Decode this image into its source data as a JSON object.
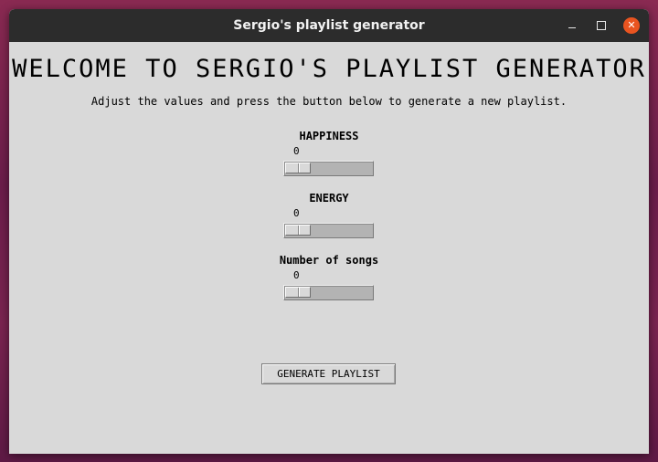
{
  "window": {
    "title": "Sergio's playlist generator",
    "close_glyph": "✕",
    "controls": [
      "minimize-icon",
      "maximize-icon",
      "close-icon"
    ],
    "close_color": "#e95420"
  },
  "main": {
    "heading": "WELCOME TO SERGIO'S PLAYLIST GENERATOR",
    "instructions": "Adjust the values and press the button below to generate a new playlist."
  },
  "scales": [
    {
      "label": "HAPPINESS",
      "value": "0"
    },
    {
      "label": "ENERGY",
      "value": "0"
    },
    {
      "label": "Number of songs",
      "value": "0"
    }
  ],
  "actions": {
    "generate_label": "GENERATE PLAYLIST"
  }
}
